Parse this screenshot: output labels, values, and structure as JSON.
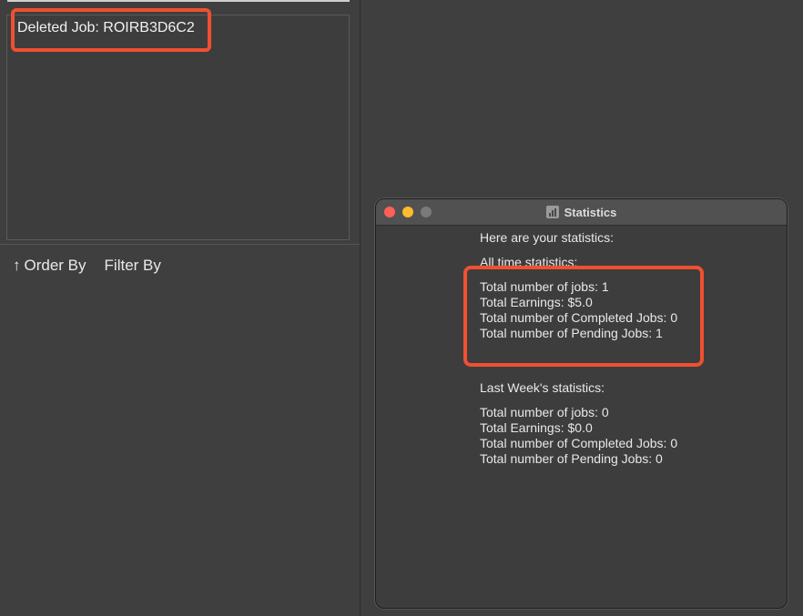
{
  "left_panel": {
    "result_text": "Deleted Job: ROIRB3D6C2",
    "toolbar": {
      "order_by_label": "Order By",
      "filter_by_label": "Filter By"
    }
  },
  "stats_window": {
    "title": "Statistics",
    "intro": "Here are your statistics:",
    "all_time": {
      "heading": "All time statistics:",
      "total_jobs": "Total number of jobs: 1",
      "total_earnings": "Total Earnings: $5.0",
      "completed_jobs": "Total number of Completed Jobs: 0",
      "pending_jobs": "Total number of Pending Jobs: 1"
    },
    "last_week": {
      "heading": "Last Week's statistics:",
      "total_jobs": "Total number of jobs: 0",
      "total_earnings": "Total Earnings: $0.0",
      "completed_jobs": "Total number of Completed Jobs: 0",
      "pending_jobs": "Total number of Pending Jobs: 0"
    }
  },
  "colors": {
    "highlight": "#f05032",
    "background": "#3f3f3f"
  },
  "icons": {
    "order_by": "arrow-up-icon",
    "window_title": "chart-icon"
  }
}
